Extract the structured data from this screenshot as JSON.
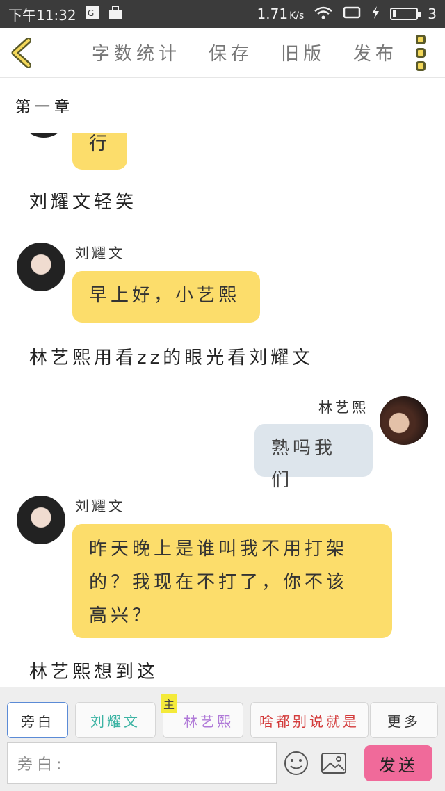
{
  "status_bar": {
    "time": "下午11:32",
    "net_speed": "1.71",
    "net_unit": "K/s",
    "battery_level": "3"
  },
  "toolbar": {
    "word_count_label": "字数统计",
    "save_label": "保存",
    "old_version_label": "旧版",
    "publish_label": "发布"
  },
  "chapter": {
    "title": "第一章"
  },
  "messages": [
    {
      "type": "bubble-partial",
      "text": "行"
    },
    {
      "type": "narration",
      "text": "刘耀文轻笑"
    },
    {
      "type": "left",
      "sender": "刘耀文",
      "text": "早上好，小艺熙"
    },
    {
      "type": "narration",
      "text": "林艺熙用看zz的眼光看刘耀文"
    },
    {
      "type": "right",
      "sender": "林艺熙",
      "text": "熟吗我们"
    },
    {
      "type": "left",
      "sender": "刘耀文",
      "lines": [
        "昨天晚上是谁叫我不用打架",
        "的？我现在不打了，你不该",
        "高兴？"
      ]
    },
    {
      "type": "narration",
      "text": "林艺熙想到这"
    }
  ],
  "roles": {
    "aside": "旁白",
    "role1": "刘耀文",
    "role1_color": "#3bb3a3",
    "main_tag": "主",
    "role2": "林艺熙",
    "role2_color": "#b07ad8",
    "role3": "啥都别说就是",
    "role3_color": "#d33a3a",
    "more": "更多"
  },
  "input": {
    "placeholder": "旁白:",
    "send_label": "发送"
  },
  "colors": {
    "accent_yellow": "#fcdd6b",
    "bubble_blue": "#dde5ec",
    "send_pink": "#f06a9a"
  }
}
